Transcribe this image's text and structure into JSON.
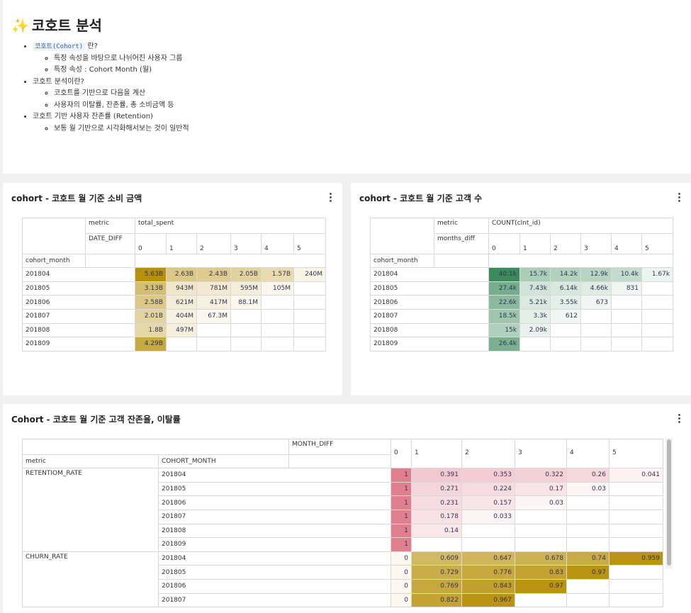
{
  "markdown": {
    "title": "코호트 분석",
    "title_icon": "sparkles-icon",
    "bullets": [
      {
        "code": "코호트(Cohort)",
        "text": "란?",
        "subs": [
          "특정 속성을 바탕으로 나뉘어진 사용자 그룹",
          "특정 속성 : Cohort Month (월)"
        ]
      },
      {
        "text": "코호트 분석이란?",
        "subs": [
          "코호트를 기반으로 다음을 계산",
          "사용자의 이탈률, 잔존률, 총 소비금액 등"
        ]
      },
      {
        "text": "코호트 기반 사용자 잔존률 (Retention)",
        "subs": [
          "보통 월 기반으로 시각화해서보는 것이 일반적"
        ]
      }
    ]
  },
  "panel1": {
    "title": "cohort - 코호트 월 기준 소비 금액",
    "metric_label": "metric",
    "metric_value": "total_spent",
    "col_dim": "DATE_DIFF",
    "row_dim": "cohort_month",
    "cols": [
      "0",
      "1",
      "2",
      "3",
      "4",
      "5"
    ],
    "rows": [
      {
        "label": "201804",
        "vals": [
          "5.63B",
          "2.63B",
          "2.43B",
          "2.05B",
          "1.57B",
          "240M"
        ]
      },
      {
        "label": "201805",
        "vals": [
          "3.13B",
          "943M",
          "781M",
          "595M",
          "105M",
          ""
        ]
      },
      {
        "label": "201806",
        "vals": [
          "2.58B",
          "621M",
          "417M",
          "88.1M",
          "",
          ""
        ]
      },
      {
        "label": "201807",
        "vals": [
          "2.01B",
          "404M",
          "67.3M",
          "",
          "",
          ""
        ]
      },
      {
        "label": "201808",
        "vals": [
          "1.8B",
          "497M",
          "",
          "",
          "",
          ""
        ]
      },
      {
        "label": "201809",
        "vals": [
          "4.29B",
          "",
          "",
          "",
          "",
          ""
        ]
      }
    ],
    "raw": [
      [
        5630000000.0,
        2630000000.0,
        2430000000.0,
        2050000000.0,
        1570000000.0,
        240000000.0
      ],
      [
        3130000000.0,
        943000000.0,
        781000000.0,
        595000000.0,
        105000000.0,
        null
      ],
      [
        2580000000.0,
        621000000.0,
        417000000.0,
        88100000.0,
        null,
        null
      ],
      [
        2010000000.0,
        404000000.0,
        67300000.0,
        null,
        null,
        null
      ],
      [
        1800000000.0,
        497000000.0,
        null,
        null,
        null,
        null
      ],
      [
        4290000000.0,
        null,
        null,
        null,
        null,
        null
      ]
    ],
    "color": "#b8900a"
  },
  "panel2": {
    "title": "cohort - 코호트 월 기준 고객 수",
    "metric_label": "metric",
    "metric_value": "COUNT(clnt_id)",
    "col_dim": "months_diff",
    "row_dim": "cohort_month",
    "cols": [
      "0",
      "1",
      "2",
      "3",
      "4",
      "5"
    ],
    "rows": [
      {
        "label": "201804",
        "vals": [
          "40.1k",
          "15.7k",
          "14.2k",
          "12.9k",
          "10.4k",
          "1.67k"
        ]
      },
      {
        "label": "201805",
        "vals": [
          "27.4k",
          "7.43k",
          "6.14k",
          "4.66k",
          "831",
          ""
        ]
      },
      {
        "label": "201806",
        "vals": [
          "22.6k",
          "5.21k",
          "3.55k",
          "673",
          "",
          ""
        ]
      },
      {
        "label": "201807",
        "vals": [
          "18.5k",
          "3.3k",
          "612",
          "",
          "",
          ""
        ]
      },
      {
        "label": "201808",
        "vals": [
          "15k",
          "2.09k",
          "",
          "",
          "",
          ""
        ]
      },
      {
        "label": "201809",
        "vals": [
          "26.4k",
          "",
          "",
          "",
          "",
          ""
        ]
      }
    ],
    "raw": [
      [
        40100,
        15700,
        14200,
        12900,
        10400,
        1670
      ],
      [
        27400,
        7430,
        6140,
        4660,
        831,
        null
      ],
      [
        22600,
        5210,
        3550,
        673,
        null,
        null
      ],
      [
        18500,
        3300,
        612,
        null,
        null,
        null
      ],
      [
        15000,
        2090,
        null,
        null,
        null,
        null
      ],
      [
        26400,
        null,
        null,
        null,
        null,
        null
      ]
    ],
    "color": "#3a8c5c"
  },
  "panel3": {
    "title": "Cohort - 코호트 월 기준 고객 잔존율, 이탈률",
    "col_dim": "MONTH_DIFF",
    "metric_label": "metric",
    "row_dim": "COHORT_MONTH",
    "cols": [
      "0",
      "1",
      "2",
      "3",
      "4",
      "5"
    ],
    "groups": [
      {
        "label": "RETENTIOM_RATE",
        "color": "#e0808e",
        "rows": [
          {
            "label": "201804",
            "vals": [
              "1",
              "0.391",
              "0.353",
              "0.322",
              "0.26",
              "0.041"
            ],
            "raw": [
              1,
              0.391,
              0.353,
              0.322,
              0.26,
              0.041
            ]
          },
          {
            "label": "201805",
            "vals": [
              "1",
              "0.271",
              "0.224",
              "0.17",
              "0.03",
              ""
            ],
            "raw": [
              1,
              0.271,
              0.224,
              0.17,
              0.03,
              null
            ]
          },
          {
            "label": "201806",
            "vals": [
              "1",
              "0.231",
              "0.157",
              "0.03",
              "",
              ""
            ],
            "raw": [
              1,
              0.231,
              0.157,
              0.03,
              null,
              null
            ]
          },
          {
            "label": "201807",
            "vals": [
              "1",
              "0.178",
              "0.033",
              "",
              "",
              ""
            ],
            "raw": [
              1,
              0.178,
              0.033,
              null,
              null,
              null
            ]
          },
          {
            "label": "201808",
            "vals": [
              "1",
              "0.14",
              "",
              "",
              "",
              ""
            ],
            "raw": [
              1,
              0.14,
              null,
              null,
              null,
              null
            ]
          },
          {
            "label": "201809",
            "vals": [
              "1",
              "",
              "",
              "",
              "",
              ""
            ],
            "raw": [
              1,
              null,
              null,
              null,
              null,
              null
            ]
          }
        ]
      },
      {
        "label": "CHURN_RATE",
        "color": "#b8900a",
        "rows": [
          {
            "label": "201804",
            "vals": [
              "0",
              "0.609",
              "0.647",
              "0.678",
              "0.74",
              "0.959"
            ],
            "raw": [
              0,
              0.609,
              0.647,
              0.678,
              0.74,
              0.959
            ]
          },
          {
            "label": "201805",
            "vals": [
              "0",
              "0.729",
              "0.776",
              "0.83",
              "0.97",
              ""
            ],
            "raw": [
              0,
              0.729,
              0.776,
              0.83,
              0.97,
              null
            ]
          },
          {
            "label": "201806",
            "vals": [
              "0",
              "0.769",
              "0.843",
              "0.97",
              "",
              ""
            ],
            "raw": [
              0,
              0.769,
              0.843,
              0.97,
              null,
              null
            ]
          },
          {
            "label": "201807",
            "vals": [
              "0",
              "0.822",
              "0.967",
              "",
              "",
              ""
            ],
            "raw": [
              0,
              0.822,
              0.967,
              null,
              null,
              null
            ]
          }
        ]
      }
    ]
  }
}
